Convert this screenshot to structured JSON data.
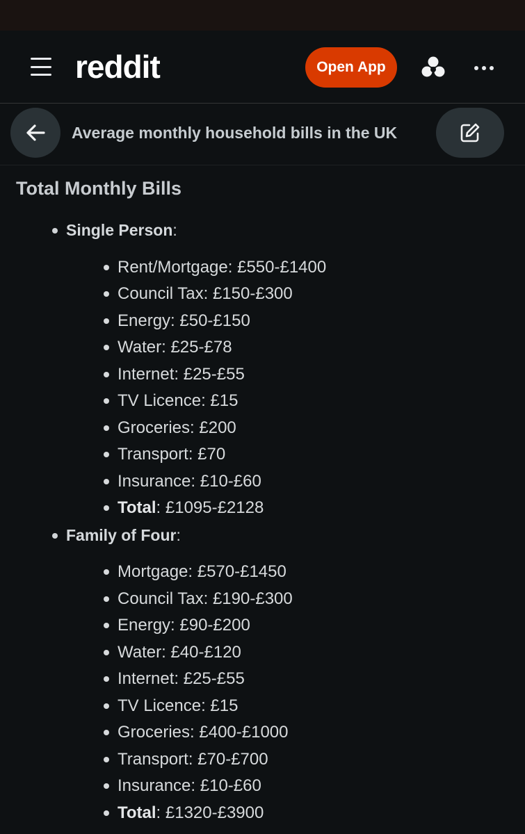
{
  "header": {
    "logo": "reddit",
    "open_app_label": "Open App",
    "accent_color": "#d93a00",
    "icons": [
      "menu-icon",
      "avatar-icon",
      "more-icon"
    ]
  },
  "post": {
    "title": "Average monthly household bills in the UK",
    "icons": [
      "back-arrow-icon",
      "edit-icon"
    ]
  },
  "content": {
    "heading": "Total Monthly Bills",
    "groups": [
      {
        "label": "Single Person",
        "suffix": ":",
        "items": [
          {
            "name": "Rent/Mortgage",
            "value": ": £550-£1400"
          },
          {
            "name": "Council Tax",
            "value": ": £150-£300"
          },
          {
            "name": "Energy",
            "value": ": £50-£150"
          },
          {
            "name": "Water",
            "value": ": £25-£78"
          },
          {
            "name": "Internet",
            "value": ": £25-£55"
          },
          {
            "name": "TV Licence",
            "value": ": £15"
          },
          {
            "name": "Groceries",
            "value": ": £200"
          },
          {
            "name": "Transport",
            "value": ": £70"
          },
          {
            "name": "Insurance",
            "value": ": £10-£60"
          },
          {
            "name": "Total",
            "value": ": £1095-£2128",
            "bold": true
          }
        ]
      },
      {
        "label": "Family of Four",
        "suffix": ":",
        "items": [
          {
            "name": "Mortgage",
            "value": ": £570-£1450"
          },
          {
            "name": "Council Tax",
            "value": ": £190-£300"
          },
          {
            "name": "Energy",
            "value": ": £90-£200"
          },
          {
            "name": "Water",
            "value": ": £40-£120"
          },
          {
            "name": "Internet",
            "value": ": £25-£55"
          },
          {
            "name": "TV Licence",
            "value": ": £15"
          },
          {
            "name": "Groceries",
            "value": ": £400-£1000"
          },
          {
            "name": "Transport",
            "value": ": £70-£700"
          },
          {
            "name": "Insurance",
            "value": ": £10-£60"
          },
          {
            "name": "Total",
            "value": ": £1320-£3900",
            "bold": true
          }
        ]
      }
    ]
  }
}
